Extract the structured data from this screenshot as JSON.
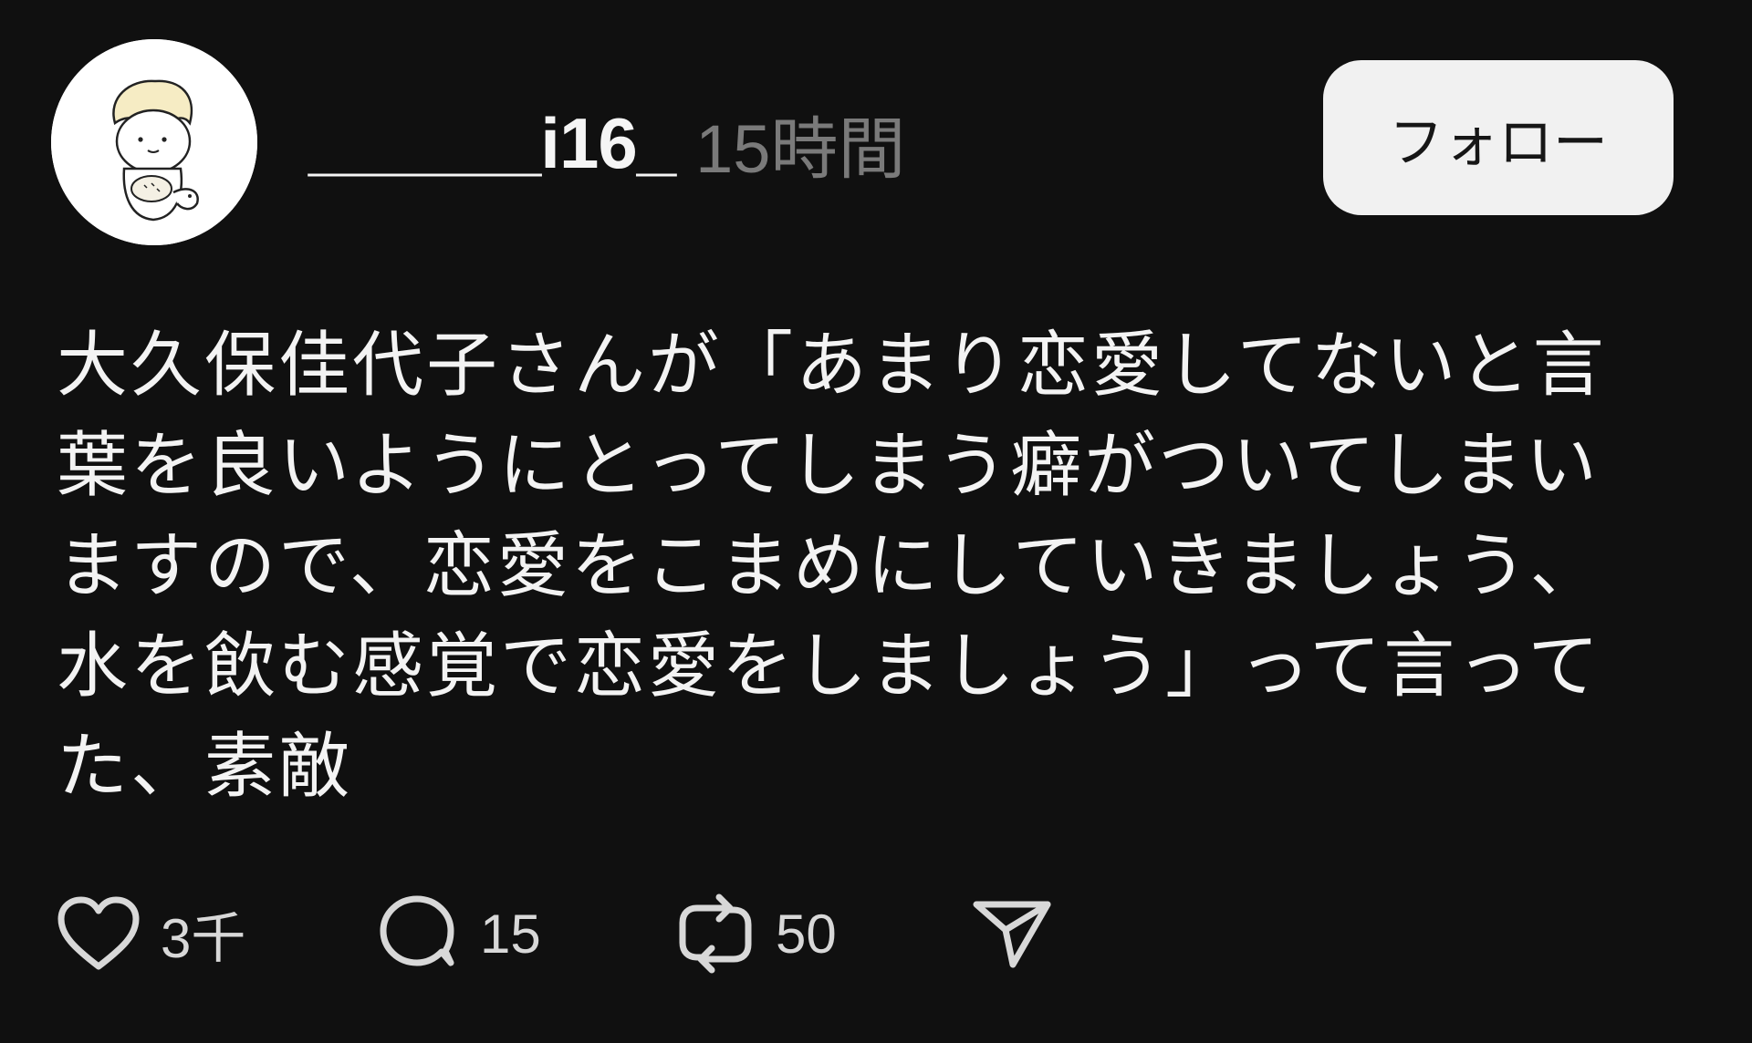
{
  "post": {
    "author": "______i16_",
    "timestamp": "15時間",
    "follow_label": "フォロー",
    "body": "大久保佳代子さんが「あまり恋愛してないと言葉を良いようにとってしまう癖がついてしまいますので、恋愛をこまめにしていきましょう、水を飲む感覚で恋愛をしましょう」って言ってた、素敵",
    "actions": {
      "like_count": "3千",
      "reply_count": "15",
      "repost_count": "50"
    }
  },
  "icons": {
    "like": "heart-icon",
    "reply": "speech-bubble-icon",
    "repost": "repost-arrows-icon",
    "share": "send-icon"
  },
  "colors": {
    "background": "#101010",
    "text": "#f3f3f3",
    "muted": "#7a7a7a",
    "button_bg": "#f1f1f1"
  }
}
